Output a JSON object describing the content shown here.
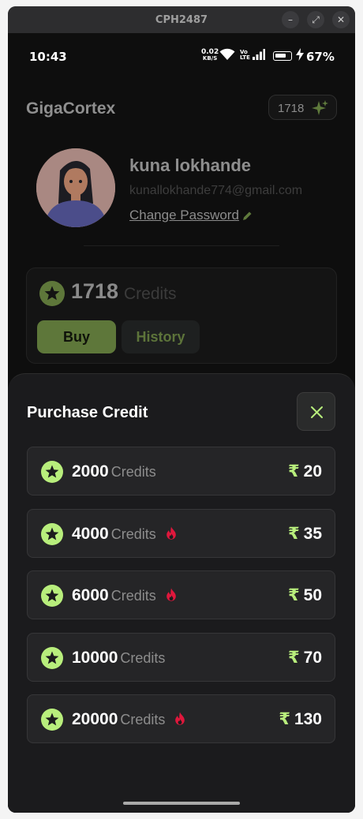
{
  "window": {
    "title": "CPH2487",
    "min_glyph": "–",
    "max_glyph": "⤢",
    "close_glyph": "✕"
  },
  "status_bar": {
    "time": "10:43",
    "net_speed_value": "0.02",
    "net_speed_unit": "KB/S",
    "volte_line1": "Vo",
    "volte_line2": "LTE",
    "battery": "67%"
  },
  "header": {
    "app_title": "GigaCortex",
    "credit_chip_value": "1718"
  },
  "profile": {
    "name": "kuna lokhande",
    "email": "kunallokhande774@gmail.com",
    "change_password_label": "Change Password"
  },
  "balance": {
    "amount": "1718",
    "label": "Credits",
    "buy_label": "Buy",
    "history_label": "History"
  },
  "sheet": {
    "title": "Purchase Credit",
    "plans": [
      {
        "credits": "2000",
        "unit": "Credits",
        "hot": false,
        "currency": "₹",
        "price": "20"
      },
      {
        "credits": "4000",
        "unit": "Credits",
        "hot": true,
        "currency": "₹",
        "price": "35"
      },
      {
        "credits": "6000",
        "unit": "Credits",
        "hot": true,
        "currency": "₹",
        "price": "50"
      },
      {
        "credits": "10000",
        "unit": "Credits",
        "hot": false,
        "currency": "₹",
        "price": "70"
      },
      {
        "credits": "20000",
        "unit": "Credits",
        "hot": true,
        "currency": "₹",
        "price": "130"
      }
    ]
  },
  "colors": {
    "accent_green": "#b8ee7c",
    "buy_button": "#5e773a",
    "fire_red": "#e0173c",
    "sheet_bg": "#1b1b1d",
    "plan_bg": "#252527"
  },
  "icons": {
    "credit": "star-in-circle-icon",
    "hot": "fire-icon",
    "close": "close-icon",
    "edit": "pencil-icon",
    "chip": "sparkle-icon"
  }
}
